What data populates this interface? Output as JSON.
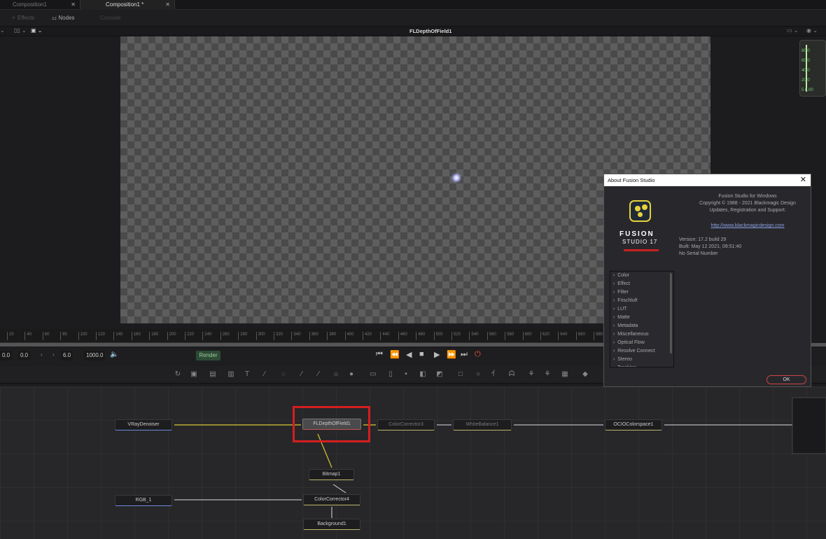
{
  "tabs": [
    {
      "label": "Composition1"
    },
    {
      "label": "Composition1 *"
    }
  ],
  "toolbar": {
    "effects": "Effects",
    "nodes": "Nodes",
    "console": "Console"
  },
  "viewer": {
    "title": "FLDepthOfField1"
  },
  "scope": {
    "labels": [
      "80.0",
      "60.0",
      "40.0",
      "20.0",
      "5 0.00"
    ]
  },
  "ruler": {
    "ticks": [
      "20",
      "40",
      "60",
      "80",
      "100",
      "120",
      "140",
      "160",
      "180",
      "200",
      "220",
      "240",
      "260",
      "280",
      "300",
      "320",
      "340",
      "360",
      "380",
      "400",
      "420",
      "440",
      "460",
      "480",
      "500",
      "520",
      "540",
      "560",
      "580",
      "600",
      "620",
      "640",
      "660",
      "680"
    ]
  },
  "transport": {
    "start": "0.0",
    "current": "0.0",
    "step": "6.0",
    "end": "1000.0",
    "render": "Render"
  },
  "nodes": {
    "vray": "VRayDenoiser",
    "fldof": "FLDepthOfField1",
    "cc3": "ColorCorrector3",
    "wb": "WhiteBalance1",
    "ocio": "OCIOColorspace1",
    "bitmap": "Bitmap1",
    "rgb": "RGB_1",
    "cc4": "ColorCorrector4",
    "bg": "Background1"
  },
  "dialog": {
    "title": "About Fusion Studio",
    "product": "Fusion Studio for Windows",
    "copyright": "Copyright © 1988 - 2021 Blackmagic Design",
    "support": "Updates, Registration and Support:",
    "url": "http://www.blackmagicdesign.com",
    "version": "Version: 17.2 build 29",
    "built": "Built: May 12 2021, 09:51:40",
    "serial": "No Serial Number",
    "logo_line1": "FUSION",
    "logo_line2": "STUDIO 17",
    "list": [
      "Color",
      "Effect",
      "Filter",
      "Frischluft",
      "LUT",
      "Matte",
      "Metadata",
      "Miscellaneous",
      "Optical Flow",
      "Resolve Connect",
      "Stereo",
      "Tracking"
    ],
    "ok": "OK"
  },
  "colors": {
    "accent_red": "#d51e1e",
    "wire_yellow": "#d8c830",
    "render_green": "#2d4a35"
  }
}
